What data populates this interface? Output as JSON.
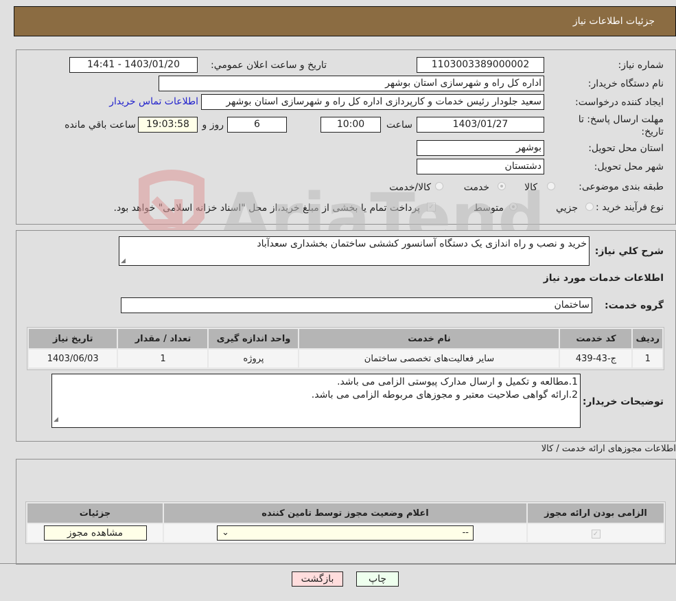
{
  "header": {
    "title": "جزئیات اطلاعات نیاز"
  },
  "form": {
    "need_number": {
      "label": "شماره نیاز:",
      "value": "1103003389000002"
    },
    "announce_datetime": {
      "label": "تاريخ و ساعت اعلان عمومي:",
      "value": "1403/01/20 - 14:41"
    },
    "buyer_org": {
      "label": "نام دستگاه خريدار:",
      "value": "اداره کل راه و شهرسازی استان بوشهر"
    },
    "requester": {
      "label": "ايجاد کننده درخواست:",
      "value": "سعید جلودار رئیس خدمات و کارپردازی اداره کل راه و شهرسازی استان بوشهر"
    },
    "buyer_contact_link": "اطلاعات تماس خريدار",
    "deadline": {
      "label": "مهلت ارسال پاسخ: تا تاريخ:",
      "date": "1403/01/27",
      "time_label": "ساعت",
      "time": "10:00",
      "days": "6",
      "days_label": "روز و",
      "remaining": "19:03:58",
      "remaining_label": "ساعت باقي مانده"
    },
    "province": {
      "label": "استان محل تحويل:",
      "value": "بوشهر"
    },
    "city": {
      "label": "شهر محل تحويل:",
      "value": "دشتستان"
    },
    "category": {
      "label": "طبقه بندی موضوعی:",
      "options": [
        {
          "label": "کالا",
          "checked": false
        },
        {
          "label": "خدمت",
          "checked": true
        },
        {
          "label": "کالا/خدمت",
          "checked": false
        }
      ]
    },
    "purchase_type": {
      "label": "نوع فرآيند خريد :",
      "options": [
        {
          "label": "جزيي",
          "checked": false
        },
        {
          "label": "متوسط",
          "checked": true
        }
      ],
      "treasury_checkbox_label": "پرداخت تمام يا بخشی از مبلغ خريد،از محل \"اسناد خزانه اسلامی\" خواهد بود.",
      "treasury_checked": true
    }
  },
  "description": {
    "label": "شرح کلي نياز:",
    "value": "خريد و نصب و راه اندازی يک دستگاه آسانسور کششی ساختمان بخشداری سعدآباد"
  },
  "services": {
    "section_title": "اطلاعات خدمات مورد نياز",
    "group_label": "گروه خدمت:",
    "group_value": "ساختمان",
    "table": {
      "headers": [
        "رديف",
        "کد خدمت",
        "نام خدمت",
        "واحد اندازه گيری",
        "تعداد / مقدار",
        "تاريخ نياز"
      ],
      "rows": [
        [
          "1",
          "ج-43-439",
          "ساير فعاليت‌های تخصصی ساختمان",
          "پروژه",
          "1",
          "1403/06/03"
        ]
      ]
    }
  },
  "buyer_notes": {
    "label": "توضيحات خريدار:",
    "lines": [
      "1.مطالعه و تکميل و ارسال مدارک پيوستی الزامی می باشد.",
      "2.ارائه گواهی صلاحيت معتبر و مجوزهای مربوطه الزامی می باشد."
    ]
  },
  "permits": {
    "section_title": "اطلاعات مجوزهای ارائه خدمت / کالا",
    "table": {
      "headers": [
        "الزامی بودن ارائه مجوز",
        "اعلام وضعيت مجوز توسط تامين کننده",
        "جزئيات"
      ],
      "rows": [
        {
          "required_checked": true,
          "status_select": "--",
          "details_button": "مشاهده مجوز"
        }
      ]
    }
  },
  "buttons": {
    "print": "چاپ",
    "back": "بازگشت"
  },
  "watermark": {
    "text": "AriaTender.neT"
  }
}
